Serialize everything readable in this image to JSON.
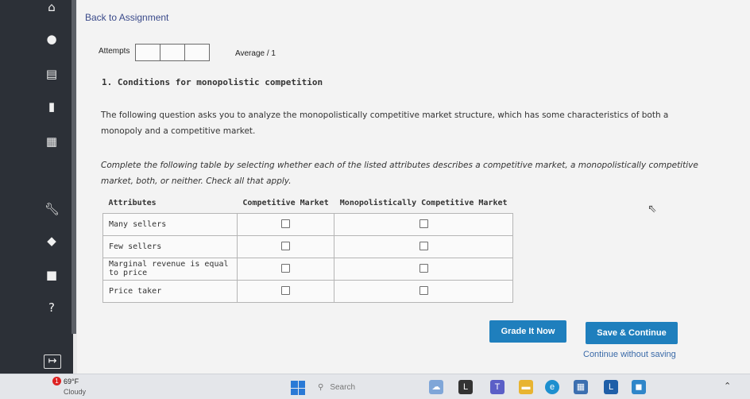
{
  "navigation": {
    "back_label": "Back to Assignment"
  },
  "attempts": {
    "label": "Attempts",
    "average_label": "Average / 1"
  },
  "question": {
    "title": "1. Conditions for monopolistic competition",
    "intro": "The following question asks you to analyze the monopolistically competitive market structure, which has some characteristics of both a monopoly and a competitive market.",
    "instructions": "Complete the following table by selecting whether each of the listed attributes describes a competitive market, a monopolistically competitive market, both, or neither. Check all that apply."
  },
  "table": {
    "headers": [
      "Attributes",
      "Competitive Market",
      "Monopolistically Competitive Market"
    ],
    "rows": [
      {
        "attribute": "Many sellers",
        "competitive": false,
        "monopolistic": false
      },
      {
        "attribute": "Few sellers",
        "competitive": false,
        "monopolistic": false
      },
      {
        "attribute": "Marginal revenue is equal to price",
        "competitive": false,
        "monopolistic": false
      },
      {
        "attribute": "Price taker",
        "competitive": false,
        "monopolistic": false
      }
    ]
  },
  "actions": {
    "grade_label": "Grade It Now",
    "save_label": "Save & Continue",
    "continue_label": "Continue without saving"
  },
  "sidebar_icons": [
    "home-icon",
    "user-icon",
    "document-icon",
    "book-icon",
    "calendar-icon",
    "wrench-icon",
    "graduation-cap-icon",
    "briefcase-icon",
    "help-icon"
  ],
  "taskbar": {
    "weather_temp": "69°F",
    "weather_condition": "Cloudy",
    "weather_badge": "1",
    "search_placeholder": "Search"
  },
  "colors": {
    "sidebar": "#2c3037",
    "button": "#1f7fbd",
    "link": "#3a4a8a"
  }
}
